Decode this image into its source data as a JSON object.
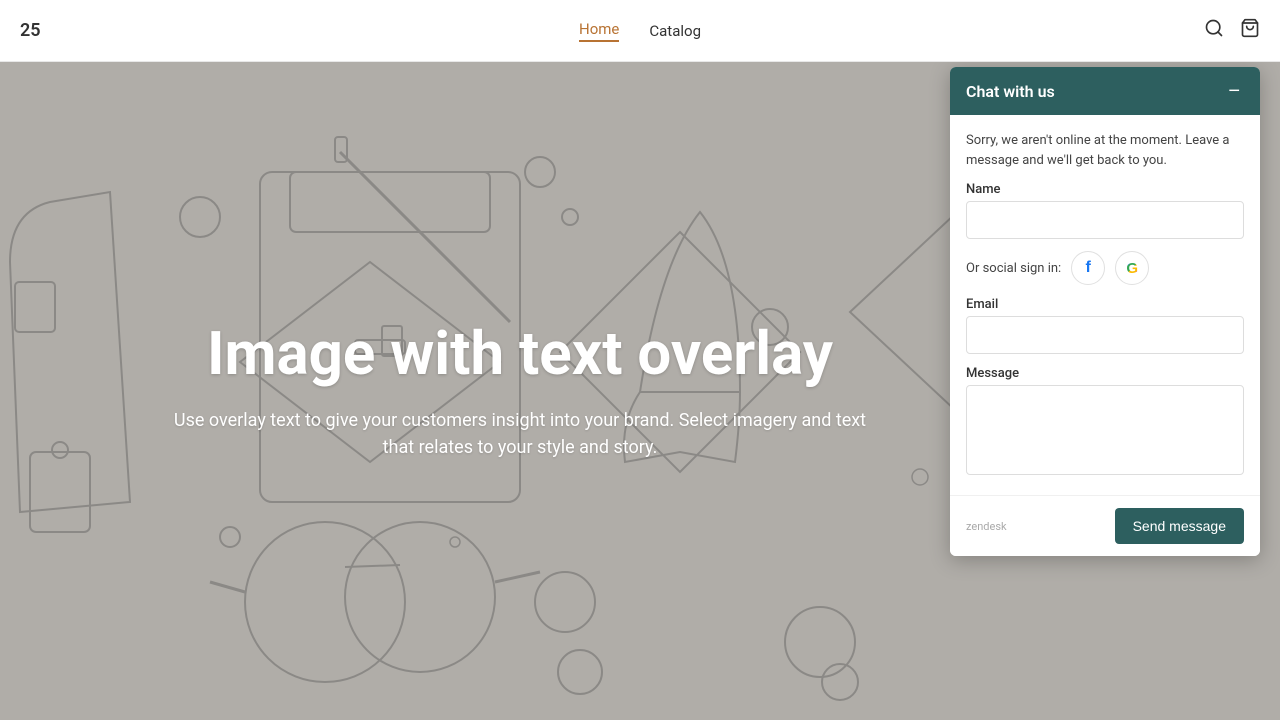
{
  "navbar": {
    "brand": "25",
    "links": [
      {
        "label": "Home",
        "active": true
      },
      {
        "label": "Catalog",
        "active": false
      }
    ],
    "icons": {
      "search": "search-icon",
      "cart": "cart-icon"
    }
  },
  "hero": {
    "title": "Image with text overlay",
    "subtitle": "Use overlay text to give your customers insight into your brand. Select imagery and text that relates to your style and story."
  },
  "chat": {
    "header_title": "Chat with us",
    "minimize_label": "−",
    "offline_message": "Sorry, we aren't online at the moment. Leave a message and we'll get back to you.",
    "name_label": "Name",
    "name_placeholder": "",
    "social_signin_label": "Or social sign in:",
    "email_label": "Email",
    "email_placeholder": "",
    "message_label": "Message",
    "message_placeholder": "",
    "zendesk_label": "zendesk",
    "send_button_label": "Send message"
  }
}
